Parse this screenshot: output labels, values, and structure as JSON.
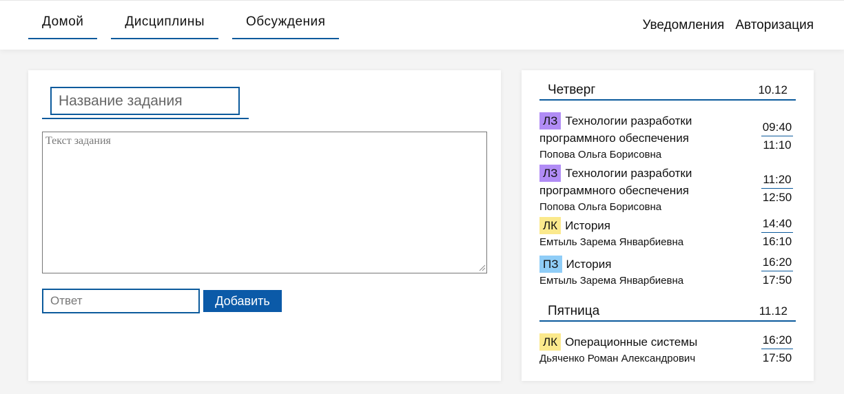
{
  "nav": {
    "left": [
      "Домой",
      "Дисциплины",
      "Обсуждения"
    ],
    "notifications": "Уведомления",
    "auth": "Авторизация"
  },
  "task": {
    "title_placeholder": "Название задания",
    "text_placeholder": "Текст задания",
    "answer_placeholder": "Ответ",
    "add_label": "Добавить"
  },
  "colors": {
    "accent": "#0b5a9c",
    "lz": "#b18cf5",
    "lk": "#fbe98c",
    "pz": "#8fcdf7"
  },
  "schedule": {
    "days": [
      {
        "name": "Четверг",
        "date": "10.12",
        "lessons": [
          {
            "type": "ЛЗ",
            "title": "Технологии разработки программного обеспечения",
            "teacher": "Попова Ольга Борисовна",
            "start": "09:40",
            "end": "11:10"
          },
          {
            "type": "ЛЗ",
            "title": "Технологии разработки программного обеспечения",
            "teacher": "Попова Ольга Борисовна",
            "start": "11:20",
            "end": "12:50"
          },
          {
            "type": "ЛК",
            "title": "История",
            "teacher": "Емтыль Зарема Январбиевна",
            "start": "14:40",
            "end": "16:10"
          },
          {
            "type": "ПЗ",
            "title": "История",
            "teacher": "Емтыль Зарема Январбиевна",
            "start": "16:20",
            "end": "17:50"
          }
        ]
      },
      {
        "name": "Пятница",
        "date": "11.12",
        "lessons": [
          {
            "type": "ЛК",
            "title": "Операционные системы",
            "teacher": "Дьяченко Роман Александрович",
            "start": "16:20",
            "end": "17:50"
          }
        ]
      }
    ]
  }
}
